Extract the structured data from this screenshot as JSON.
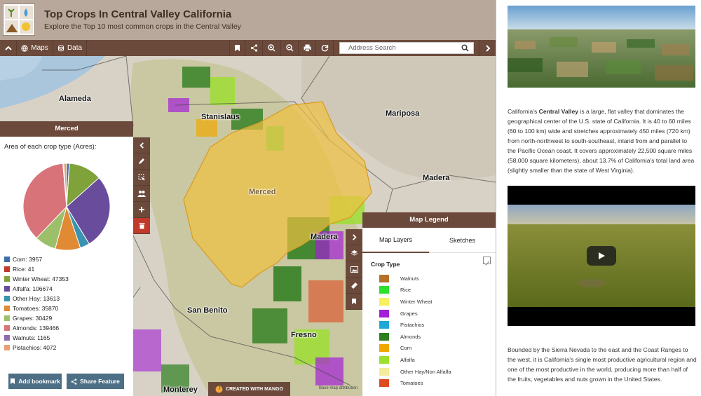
{
  "header": {
    "title": "Top Crops In Central Valley California",
    "subtitle": "Explore the Top 10 most common crops in the Central Valley"
  },
  "toolbar": {
    "maps_label": "Maps",
    "data_label": "Data",
    "search_placeholder": "Address Search"
  },
  "map": {
    "county_labels": {
      "alameda": "Alameda",
      "stanislaus": "Stanislaus",
      "mariposa": "Mariposa",
      "madera_north": "Madera",
      "merced": "Merced",
      "madera": "Madera",
      "san_benito": "San Benito",
      "fresno": "Fresno",
      "monterey": "Monterey"
    },
    "highlight_color": "#f0c040"
  },
  "county_panel": {
    "title": "Merced",
    "chart_title": "Area of each crop type (Acres):",
    "buttons": {
      "bookmark": "Add bookmark",
      "share": "Share Feature"
    }
  },
  "chart_data": {
    "type": "pie",
    "title": "Area of each crop type (Acres):",
    "categories": [
      "Corn",
      "Rice",
      "Winter Wheat",
      "Alfalfa",
      "Other Hay",
      "Tomatoes",
      "Grapes",
      "Almonds",
      "Walnuts",
      "Pistachios"
    ],
    "values": [
      3957,
      41,
      47353,
      106674,
      13613,
      35870,
      30429,
      139466,
      1165,
      4072
    ],
    "colors": [
      "#3d6fa8",
      "#c0392b",
      "#7fa23a",
      "#6a4c9c",
      "#3a93b0",
      "#e08a34",
      "#9cc06a",
      "#d9737a",
      "#8e6bb0",
      "#e8a070"
    ],
    "legend_items": [
      "Corn: 3957",
      "Rice: 41",
      "Winter Wheat: 47353",
      "Alfalfa: 106674",
      "Other Hay: 13613",
      "Tomatoes: 35870",
      "Grapes: 30429",
      "Almonds: 139466",
      "Walnuts: 1165",
      "Pistachios: 4072"
    ]
  },
  "legend_panel": {
    "title": "Map Legend",
    "tab_map_layers": "Map Layers",
    "tab_sketches": "Sketches",
    "group_label": "Crop Type",
    "crops": [
      {
        "label": "Walnuts",
        "color": "#b5712a"
      },
      {
        "label": "Rice",
        "color": "#2ee02e"
      },
      {
        "label": "Winter Wheat",
        "color": "#f5f060"
      },
      {
        "label": "Grapes",
        "color": "#a31fd6"
      },
      {
        "label": "Pistachios",
        "color": "#1fa8d6"
      },
      {
        "label": "Almonds",
        "color": "#2e7d1f"
      },
      {
        "label": "Corn",
        "color": "#f0a800"
      },
      {
        "label": "Alfalfa",
        "color": "#9be02e"
      },
      {
        "label": "Other Hay/Non Alfalfa",
        "color": "#f2ec9b"
      },
      {
        "label": "Tomatoes",
        "color": "#e04a1f"
      }
    ]
  },
  "footer": {
    "mango_badge": "CREATED WITH MANGO",
    "basemap_attribution": "Base map attribution"
  },
  "right_pane": {
    "intro_prefix": "California's ",
    "intro_bold": "Central Valley",
    "intro_rest": " is a large, flat valley that dominates the geographical center of the U.S. state of California. It is 40 to 60 miles (60 to 100 km) wide and stretches approximately 450 miles (720 km) from north-northwest to south-southeast, inland from and parallel to the Pacific Ocean coast. It covers approximately 22,500 square miles (58,000 square kilometers), about 13.7% of California's total land area (slightly smaller than the state of West Virginia).",
    "outro": "Bounded by the Sierra Nevada to the east and the Coast Ranges to the west, it is California's single most productive agricultural region and one of the most productive in the world, producing more than half of the fruits, vegetables and nuts grown in the United States."
  }
}
